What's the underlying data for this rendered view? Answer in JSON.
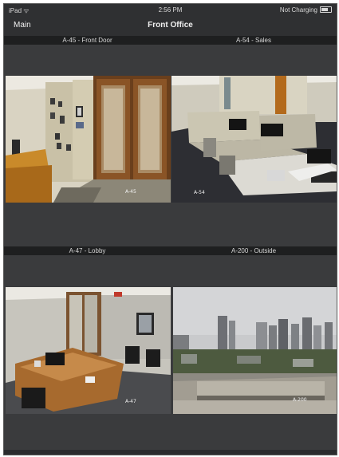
{
  "status": {
    "left": "iPad ᯤ",
    "time": "2:56 PM",
    "right": "Not Charging"
  },
  "nav": {
    "back": "Main",
    "title": "Front Office"
  },
  "cameras": [
    {
      "label": "A-45 - Front Door",
      "overlay": "A-45"
    },
    {
      "label": "A-54 - Sales",
      "overlay": "A-54"
    },
    {
      "label": "A-47 - Lobby",
      "overlay": "A-47"
    },
    {
      "label": "A-200 - Outside",
      "overlay": "A-200"
    }
  ]
}
